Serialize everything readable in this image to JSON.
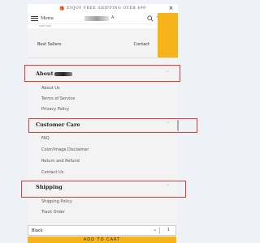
{
  "promo": {
    "text": "ENJOY FREE SHIPPING OVER $99",
    "close": "×"
  },
  "header": {
    "menu_label": "Menu",
    "logo_mark": "A",
    "cart_count": "0"
  },
  "sub_strip": {
    "text": "sale   tots"
  },
  "quick_links": {
    "left": "Best Sellers",
    "right": "Contact"
  },
  "sections": [
    {
      "title": "About",
      "links": [
        "About Us",
        "Terms of Service",
        "Privacy Policy"
      ]
    },
    {
      "title": "Customer Care",
      "links": [
        "FAQ",
        "Color/Image Disclaimer",
        "Return and Refund",
        "Contact Us"
      ]
    },
    {
      "title": "Shipping",
      "links": [
        "Shipping Policy",
        "Track Order"
      ]
    }
  ],
  "chevron": "^",
  "bottom": {
    "variant": "Black",
    "qty": "1",
    "pill": "",
    "add_to_cart": "ADD TO CART"
  },
  "colors": {
    "accent": "#f6b31a",
    "highlight": "#e53935"
  }
}
